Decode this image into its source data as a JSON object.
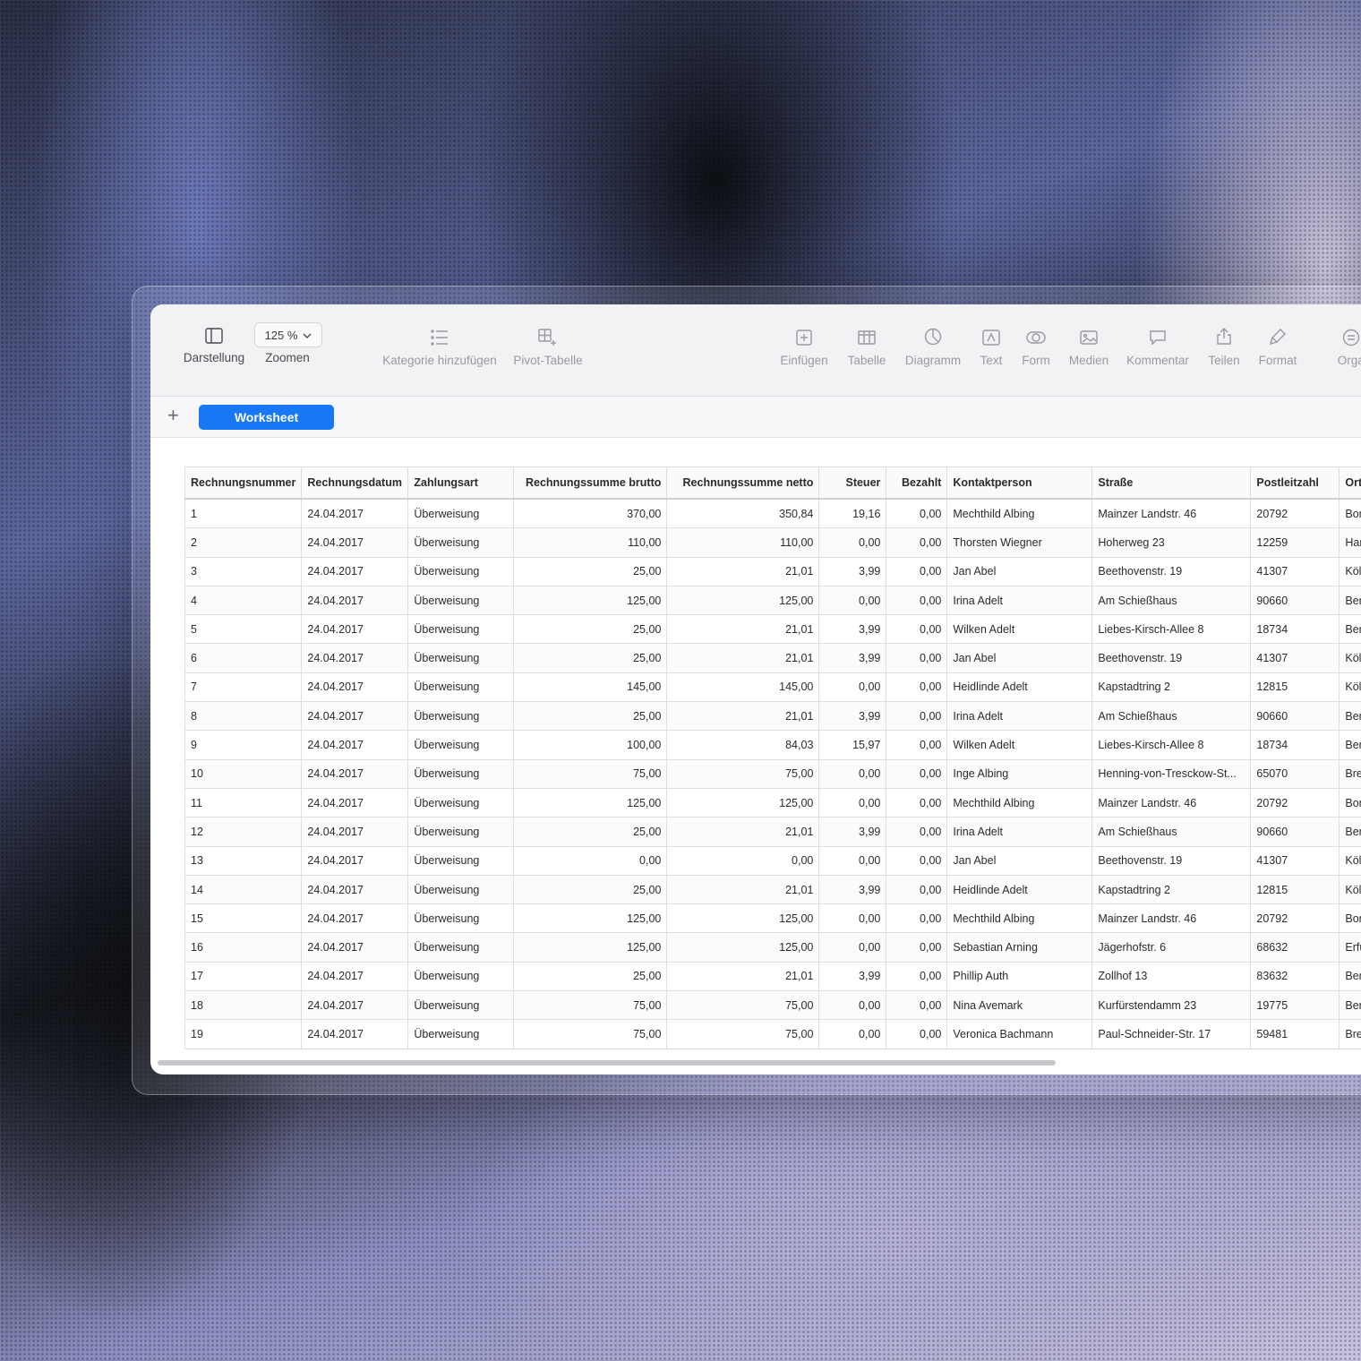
{
  "toolbar": {
    "darstellung": "Darstellung",
    "zoom_value": "125 %",
    "zoomen": "Zoomen",
    "kategorie": "Kategorie hinzufügen",
    "pivot": "Pivot-Tabelle",
    "einfuegen": "Einfügen",
    "tabelle": "Tabelle",
    "diagramm": "Diagramm",
    "text": "Text",
    "form": "Form",
    "medien": "Medien",
    "kommentar": "Kommentar",
    "teilen": "Teilen",
    "format": "Format",
    "organisieren": "Organisi"
  },
  "tabs": {
    "add": "+",
    "active": "Worksheet"
  },
  "table": {
    "headers": [
      "Rechnungsnummer",
      "Rechnungsdatum",
      "Zahlungsart",
      "Rechnungssumme brutto",
      "Rechnungssumme netto",
      "Steuer",
      "Bezahlt",
      "Kontaktperson",
      "Straße",
      "Postleitzahl",
      "Ort"
    ],
    "rows": [
      [
        "1",
        "24.04.2017",
        "Überweisung",
        "370,00",
        "350,84",
        "19,16",
        "0,00",
        "Mechthild Albing",
        "Mainzer Landstr. 46",
        "20792",
        "Bon"
      ],
      [
        "2",
        "24.04.2017",
        "Überweisung",
        "110,00",
        "110,00",
        "0,00",
        "0,00",
        "Thorsten Wiegner",
        "Hoherweg 23",
        "12259",
        "Har"
      ],
      [
        "3",
        "24.04.2017",
        "Überweisung",
        "25,00",
        "21,01",
        "3,99",
        "0,00",
        "Jan Abel",
        "Beethovenstr. 19",
        "41307",
        "Köln"
      ],
      [
        "4",
        "24.04.2017",
        "Überweisung",
        "125,00",
        "125,00",
        "0,00",
        "0,00",
        "Irina Adelt",
        "Am Schießhaus",
        "90660",
        "Ber"
      ],
      [
        "5",
        "24.04.2017",
        "Überweisung",
        "25,00",
        "21,01",
        "3,99",
        "0,00",
        "Wilken Adelt",
        "Liebes-Kirsch-Allee 8",
        "18734",
        "Ber"
      ],
      [
        "6",
        "24.04.2017",
        "Überweisung",
        "25,00",
        "21,01",
        "3,99",
        "0,00",
        "Jan Abel",
        "Beethovenstr. 19",
        "41307",
        "Köln"
      ],
      [
        "7",
        "24.04.2017",
        "Überweisung",
        "145,00",
        "145,00",
        "0,00",
        "0,00",
        "Heidlinde Adelt",
        "Kapstadtring 2",
        "12815",
        "Köln"
      ],
      [
        "8",
        "24.04.2017",
        "Überweisung",
        "25,00",
        "21,01",
        "3,99",
        "0,00",
        "Irina Adelt",
        "Am Schießhaus",
        "90660",
        "Ber"
      ],
      [
        "9",
        "24.04.2017",
        "Überweisung",
        "100,00",
        "84,03",
        "15,97",
        "0,00",
        "Wilken Adelt",
        "Liebes-Kirsch-Allee 8",
        "18734",
        "Ber"
      ],
      [
        "10",
        "24.04.2017",
        "Überweisung",
        "75,00",
        "75,00",
        "0,00",
        "0,00",
        "Inge Albing",
        "Henning-von-Tresckow-St...",
        "65070",
        "Bre"
      ],
      [
        "11",
        "24.04.2017",
        "Überweisung",
        "125,00",
        "125,00",
        "0,00",
        "0,00",
        "Mechthild Albing",
        "Mainzer Landstr. 46",
        "20792",
        "Bon"
      ],
      [
        "12",
        "24.04.2017",
        "Überweisung",
        "25,00",
        "21,01",
        "3,99",
        "0,00",
        "Irina Adelt",
        "Am Schießhaus",
        "90660",
        "Ber"
      ],
      [
        "13",
        "24.04.2017",
        "Überweisung",
        "0,00",
        "0,00",
        "0,00",
        "0,00",
        "Jan Abel",
        "Beethovenstr. 19",
        "41307",
        "Köln"
      ],
      [
        "14",
        "24.04.2017",
        "Überweisung",
        "25,00",
        "21,01",
        "3,99",
        "0,00",
        "Heidlinde Adelt",
        "Kapstadtring 2",
        "12815",
        "Köln"
      ],
      [
        "15",
        "24.04.2017",
        "Überweisung",
        "125,00",
        "125,00",
        "0,00",
        "0,00",
        "Mechthild Albing",
        "Mainzer Landstr. 46",
        "20792",
        "Bon"
      ],
      [
        "16",
        "24.04.2017",
        "Überweisung",
        "125,00",
        "125,00",
        "0,00",
        "0,00",
        "Sebastian Arning",
        "Jägerhofstr. 6",
        "68632",
        "Erfu"
      ],
      [
        "17",
        "24.04.2017",
        "Überweisung",
        "25,00",
        "21,01",
        "3,99",
        "0,00",
        "Phillip Auth",
        "Zollhof 13",
        "83632",
        "Ber"
      ],
      [
        "18",
        "24.04.2017",
        "Überweisung",
        "75,00",
        "75,00",
        "0,00",
        "0,00",
        "Nina Avemark",
        "Kurfürstendamm 23",
        "19775",
        "Ber"
      ],
      [
        "19",
        "24.04.2017",
        "Überweisung",
        "75,00",
        "75,00",
        "0,00",
        "0,00",
        "Veronica Bachmann",
        "Paul-Schneider-Str. 17",
        "59481",
        "Bre"
      ]
    ]
  }
}
